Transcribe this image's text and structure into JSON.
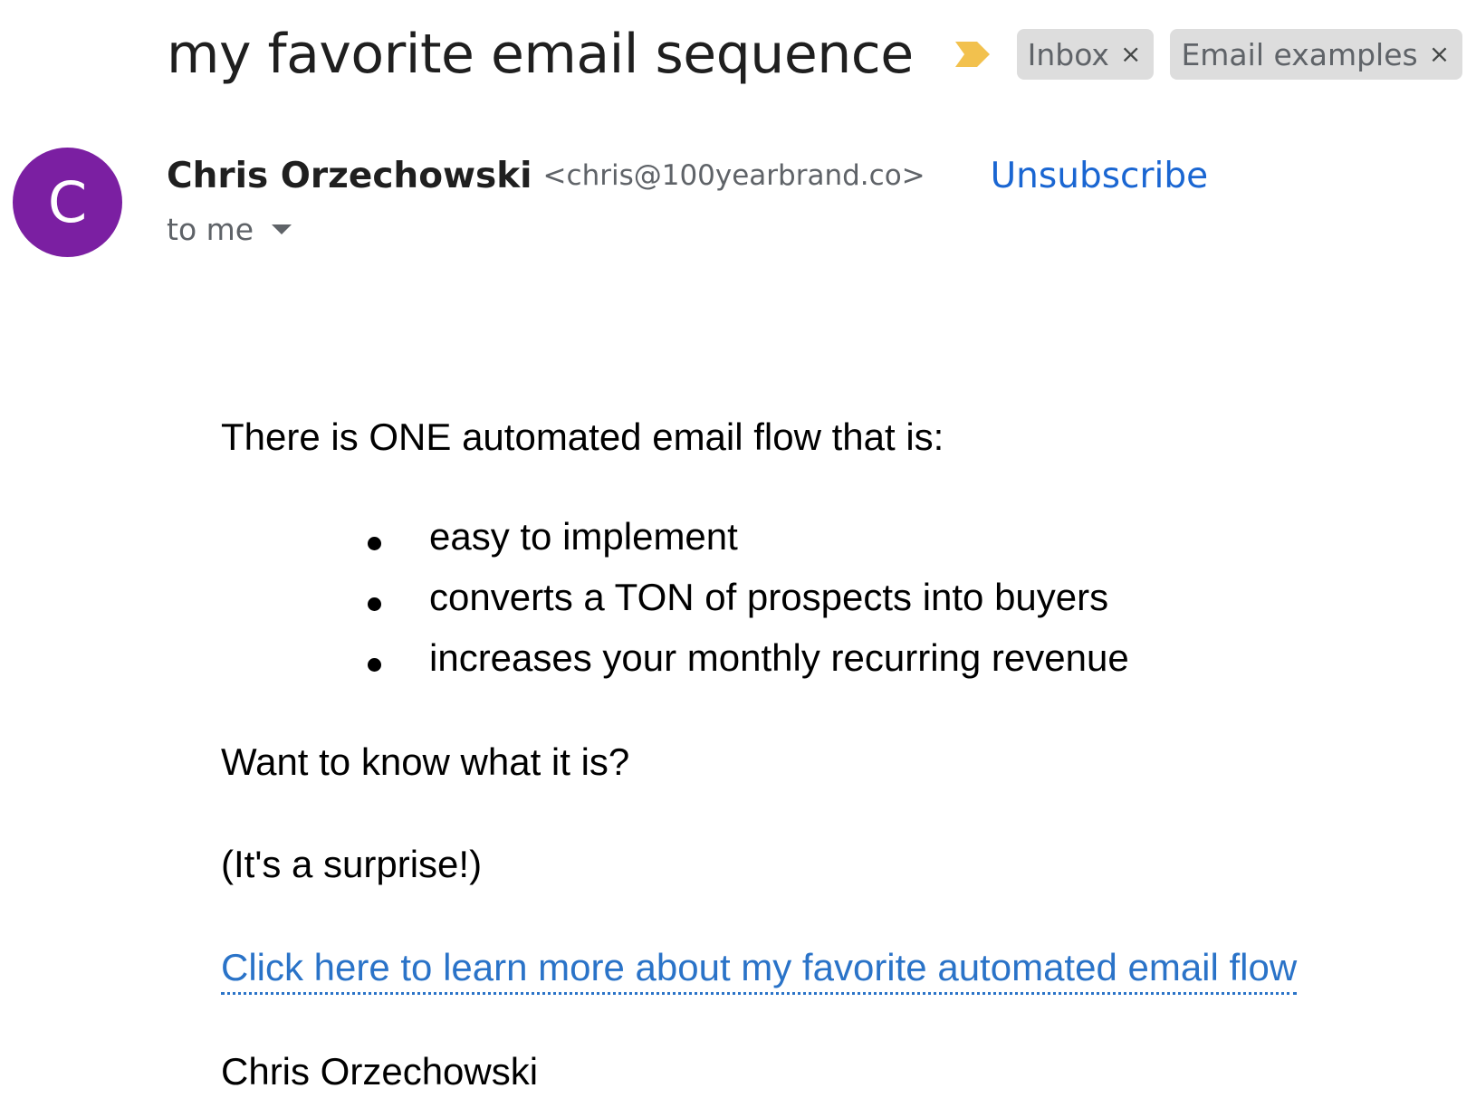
{
  "header": {
    "subject": "my favorite email sequence",
    "importance_icon": "importance-marker-icon",
    "importance_color": "#f2c14e",
    "labels": [
      {
        "text": "Inbox",
        "close": "×"
      },
      {
        "text": "Email examples",
        "close": "×"
      }
    ]
  },
  "sender": {
    "avatar_letter": "C",
    "avatar_color": "#7b1fa2",
    "name": "Chris Orzechowski",
    "email": "<chris@100yearbrand.co>",
    "unsubscribe": "Unsubscribe",
    "recipient": "to me"
  },
  "body": {
    "intro": "There is ONE automated email flow that is:",
    "bullets": [
      "easy to implement",
      "converts a TON of prospects into buyers",
      "increases your monthly recurring revenue"
    ],
    "question": "Want to know what it is?",
    "aside": "(It's a surprise!)",
    "link_text": "Click here to learn more about my favorite automated email flow",
    "signature": "Chris Orzechowski"
  },
  "colors": {
    "link": "#2a73c8",
    "unsubscribe": "#1a66d2",
    "chip_background": "#dddddd"
  }
}
